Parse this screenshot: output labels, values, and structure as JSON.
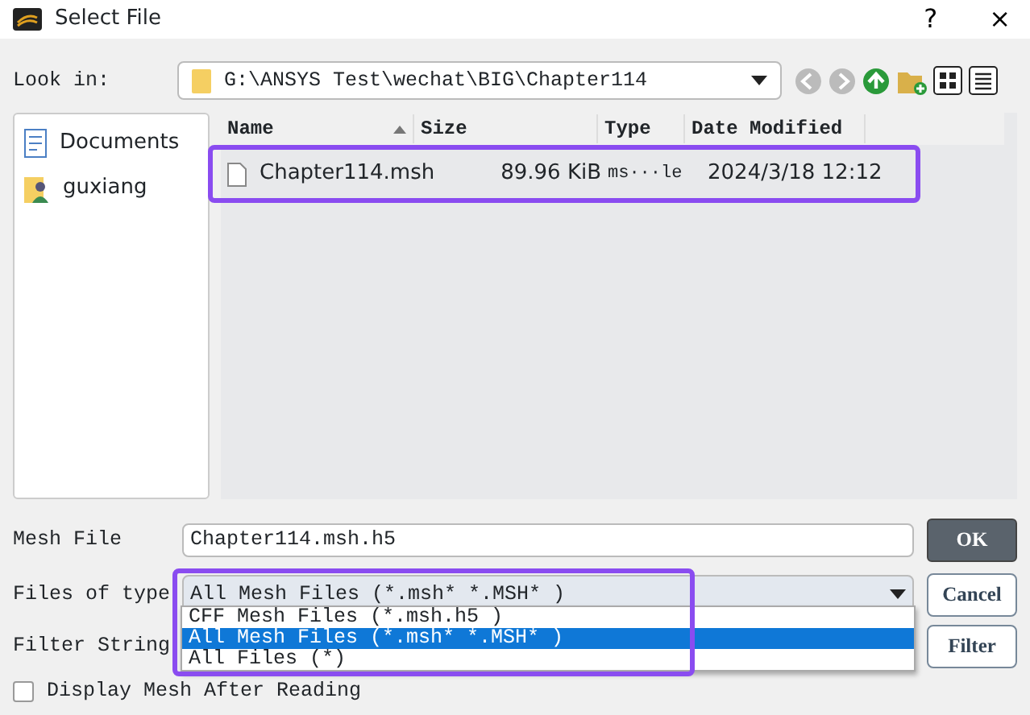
{
  "window": {
    "title": "Select File",
    "help": "?",
    "close": "×"
  },
  "look_in": {
    "label": "Look in:",
    "path": "G:\\ANSYS Test\\wechat\\BIG\\Chapter114"
  },
  "sidebar": {
    "items": [
      {
        "label": "Documents",
        "kind": "documents"
      },
      {
        "label": "guxiang",
        "kind": "user"
      }
    ]
  },
  "table": {
    "columns": [
      {
        "label": "Name",
        "sorted": true
      },
      {
        "label": "Size",
        "sorted": false
      },
      {
        "label": "Type",
        "sorted": false
      },
      {
        "label": "Date Modified",
        "sorted": false
      }
    ],
    "rows": [
      {
        "name": "Chapter114.msh",
        "size": "89.96 KiB",
        "type": "ms···le",
        "date": "2024/3/18 12:12",
        "highlighted": true
      }
    ]
  },
  "mesh_file": {
    "label": "Mesh File",
    "value": "Chapter114.msh.h5"
  },
  "files_of_type": {
    "label": "Files of type",
    "value": "All Mesh Files (*.msh* *.MSH* )",
    "expanded": true,
    "highlighted": true,
    "options": [
      {
        "label": "CFF Mesh Files (*.msh.h5 )",
        "selected": false
      },
      {
        "label": "All Mesh Files (*.msh* *.MSH* )",
        "selected": true
      },
      {
        "label": "All Files (*)",
        "selected": false
      }
    ]
  },
  "filter_string": {
    "label": "Filter String"
  },
  "buttons": [
    {
      "label": "OK",
      "kind": "primary"
    },
    {
      "label": "Cancel",
      "kind": "secondary"
    },
    {
      "label": "Filter",
      "kind": "secondary"
    }
  ],
  "display_mesh": {
    "label": "Display Mesh After Reading",
    "checked": false
  }
}
